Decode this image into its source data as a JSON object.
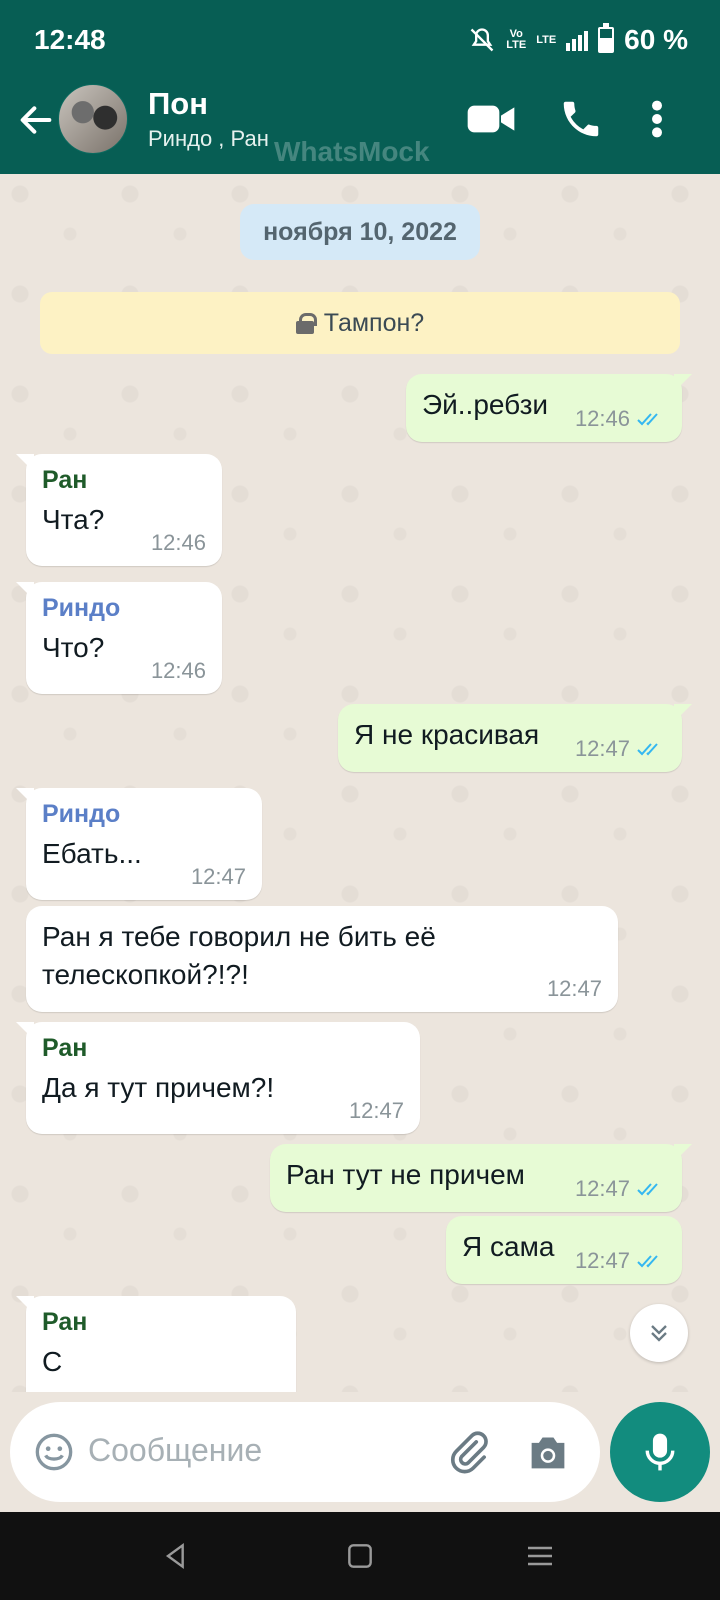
{
  "status": {
    "time": "12:48",
    "net_top": "Vo",
    "net_bottom": "LTE",
    "lte": "LTE",
    "battery_text": "60 %",
    "battery_level": 0.6
  },
  "header": {
    "title": "Пон",
    "subtitle": "Риндо , Ран",
    "watermark": "WhatsMock"
  },
  "chat": {
    "date": "ноября 10, 2022",
    "system_message": "Тампон?",
    "messages": [
      {
        "dir": "out",
        "text": "Эй..ребзи",
        "time": "12:46"
      },
      {
        "dir": "in",
        "sender": "Ран",
        "text": "Чта?",
        "time": "12:46"
      },
      {
        "dir": "in",
        "sender": "Риндо",
        "text": "Что?",
        "time": "12:46"
      },
      {
        "dir": "out",
        "text": "Я не красивая",
        "time": "12:47"
      },
      {
        "dir": "in",
        "sender": "Риндо",
        "text": "Ебать...",
        "time": "12:47"
      },
      {
        "dir": "in",
        "text": "Ран я тебе говорил не бить её телескопкой?!?!",
        "time": "12:47"
      },
      {
        "dir": "in",
        "sender": "Ран",
        "text": "Да я тут причем?!",
        "time": "12:47"
      },
      {
        "dir": "out",
        "text": "Ран тут не причем",
        "time": "12:47"
      },
      {
        "dir": "out",
        "text": "Я сама",
        "time": "12:47"
      },
      {
        "dir": "in",
        "sender": "Ран",
        "text": "С"
      }
    ]
  },
  "input": {
    "placeholder": "Сообщение"
  },
  "colors": {
    "header": "#075e54",
    "accent": "#128c7e",
    "outgoing": "#e7fbd5",
    "incoming": "#ffffff",
    "tick": "#34b7f1",
    "sender_ran": "#1f5b2a",
    "sender_rindo": "#5b7fc7"
  },
  "icons": [
    "back-arrow-icon",
    "video-call-icon",
    "phone-icon",
    "more-vert-icon",
    "lock-icon",
    "double-check-icon",
    "scroll-down-icon",
    "emoji-icon",
    "attach-icon",
    "camera-icon",
    "mic-icon",
    "nav-back-icon",
    "nav-home-icon",
    "nav-recents-icon"
  ]
}
